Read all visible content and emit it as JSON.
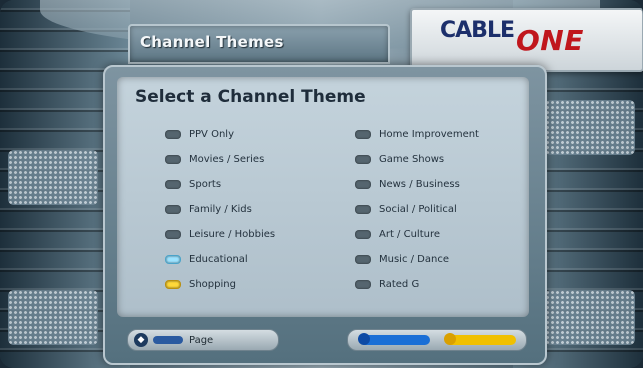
{
  "header": {
    "title": "Channel Themes"
  },
  "brand": {
    "logo_part1": "CABLE",
    "logo_part2": "ONE",
    "color_blue": "#1c2f6b",
    "color_red": "#c0161c"
  },
  "panel": {
    "heading": "Select a Channel Theme",
    "left_items": [
      {
        "label": "PPV Only",
        "bullet": "gray"
      },
      {
        "label": "Movies / Series",
        "bullet": "gray"
      },
      {
        "label": "Sports",
        "bullet": "gray"
      },
      {
        "label": "Family / Kids",
        "bullet": "gray"
      },
      {
        "label": "Leisure / Hobbies",
        "bullet": "gray"
      },
      {
        "label": "Educational",
        "bullet": "cyan"
      },
      {
        "label": "Shopping",
        "bullet": "yellow"
      }
    ],
    "right_items": [
      {
        "label": "Home Improvement",
        "bullet": "gray"
      },
      {
        "label": "Game Shows",
        "bullet": "gray"
      },
      {
        "label": "News / Business",
        "bullet": "gray"
      },
      {
        "label": "Social / Political",
        "bullet": "gray"
      },
      {
        "label": "Art / Culture",
        "bullet": "gray"
      },
      {
        "label": "Music / Dance",
        "bullet": "gray"
      },
      {
        "label": "Rated G",
        "bullet": "gray"
      }
    ],
    "footer": {
      "page_label": "Page",
      "nav_icon": "page-arrows-icon",
      "blue_key": "blue-key-icon",
      "yellow_key": "yellow-key-icon"
    }
  }
}
